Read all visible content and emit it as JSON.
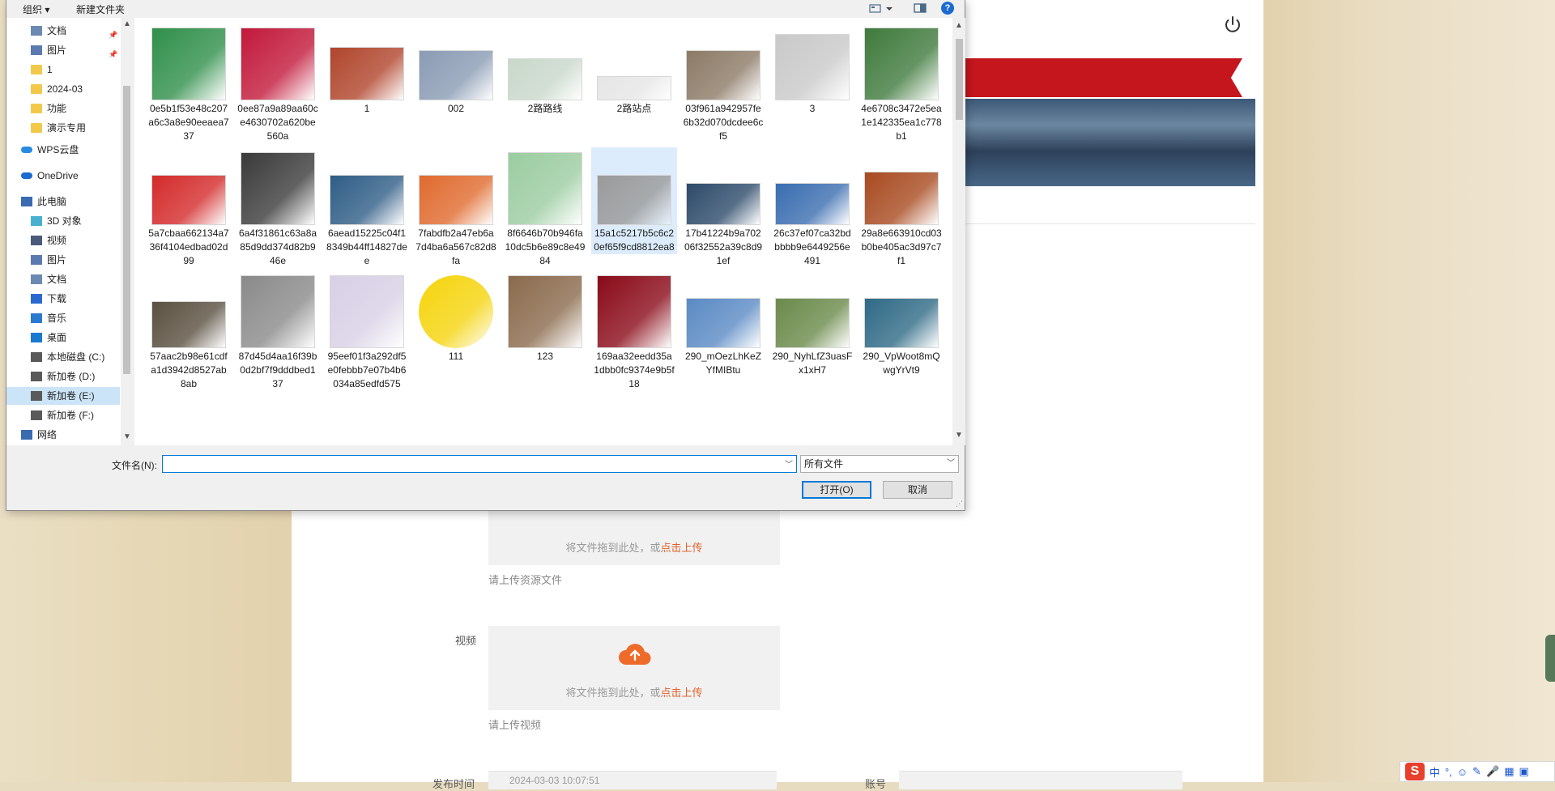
{
  "background": {
    "upload_resource": {
      "hint": "将文件拖到此处，或",
      "link": "点击上传",
      "sub": "请上传资源文件"
    },
    "video": {
      "label": "视频",
      "hint": "将文件拖到此处，或",
      "link": "点击上传",
      "sub": "请上传视频"
    },
    "publish_time": {
      "label": "发布时间",
      "value": "2024-03-03 10:07:51"
    },
    "account": {
      "label": "账号"
    }
  },
  "dialog": {
    "toolbar": {
      "organize": "组织 ▾",
      "new_folder": "新建文件夹",
      "help": "?"
    },
    "nav": [
      {
        "label": "文档",
        "icon": "document-icon",
        "pinned": true
      },
      {
        "label": "图片",
        "icon": "pictures-icon",
        "pinned": true
      },
      {
        "label": "1",
        "icon": "folder-icon"
      },
      {
        "label": "2024-03",
        "icon": "folder-icon"
      },
      {
        "label": "功能",
        "icon": "folder-icon"
      },
      {
        "label": "演示专用",
        "icon": "folder-icon"
      },
      {
        "label": "WPS云盘",
        "icon": "cloud-icon"
      },
      {
        "label": "OneDrive",
        "icon": "onedrive-icon"
      },
      {
        "label": "此电脑",
        "icon": "computer-icon"
      },
      {
        "label": "3D 对象",
        "icon": "3d-objects-icon"
      },
      {
        "label": "视频",
        "icon": "video-icon"
      },
      {
        "label": "图片",
        "icon": "pictures-icon"
      },
      {
        "label": "文档",
        "icon": "document-icon"
      },
      {
        "label": "下载",
        "icon": "download-icon"
      },
      {
        "label": "音乐",
        "icon": "music-icon"
      },
      {
        "label": "桌面",
        "icon": "desktop-icon"
      },
      {
        "label": "本地磁盘 (C:)",
        "icon": "drive-icon"
      },
      {
        "label": "新加卷 (D:)",
        "icon": "drive-icon"
      },
      {
        "label": "新加卷 (E:)",
        "icon": "drive-icon",
        "selected": true
      },
      {
        "label": "新加卷 (F:)",
        "icon": "drive-icon"
      },
      {
        "label": "网络",
        "icon": "network-icon"
      }
    ],
    "files": [
      {
        "name": "0e5b1f53e48c207a6c3a8e90eeaea737",
        "color": "#2f8f4a"
      },
      {
        "name": "0ee87a9a89aa60ce4630702a620be560a",
        "color": "#c2183a"
      },
      {
        "name": "1",
        "color": "#b0452c"
      },
      {
        "name": "002",
        "color": "#8a9bb4"
      },
      {
        "name": "2路路线",
        "color": "#c9d8cb"
      },
      {
        "name": "2路站点",
        "color": "#e6e6e6"
      },
      {
        "name": "03f961a942957fe6b32d070dcdee6cf5",
        "color": "#8c7a66"
      },
      {
        "name": "3",
        "color": "#c9c9c9"
      },
      {
        "name": "4e6708c3472e5ea1e142335ea1c778b1",
        "color": "#3f7a3c"
      },
      {
        "name": "5a7cbaa662134a736f4104edbad02d99",
        "color": "#d42a2a"
      },
      {
        "name": "6a4f31861c63a8a85d9dd374d82b946e",
        "color": "#3a3a3a"
      },
      {
        "name": "6aead15225c04f18349b44ff14827dee",
        "color": "#2f5d86"
      },
      {
        "name": "7fabdfb2a47eb6a7d4ba6a567c82d8fa",
        "color": "#e06a2e"
      },
      {
        "name": "8f6646b70b946fa10dc5b6e89c8e4984",
        "color": "#9bcca0"
      },
      {
        "name": "15a1c5217b5c6c20ef65f9cd8812ea8",
        "color": "#9a9a9a",
        "selected": true
      },
      {
        "name": "17b41224b9a70206f32552a39c8d91ef",
        "color": "#2d4a6a"
      },
      {
        "name": "26c37ef07ca32bdbbbb9e6449256e491",
        "color": "#3a6db0"
      },
      {
        "name": "29a8e663910cd03b0be405ac3d97c7f1",
        "color": "#a84a20"
      },
      {
        "name": "57aac2b98e61cdfa1d3942d8527ab8ab",
        "color": "#5a5040"
      },
      {
        "name": "87d45d4aa16f39b0d2bf7f9dddbed137",
        "color": "#8a8a8a"
      },
      {
        "name": "95eef01f3a292df5e0febbb7e07b4b6034a85edfd575",
        "color": "#d8d0e6"
      },
      {
        "name": "111",
        "color": "#f5d40c"
      },
      {
        "name": "123",
        "color": "#8a6a4c"
      },
      {
        "name": "169aa32eedd35a1dbb0fc9374e9b5f18",
        "color": "#8a0a18"
      },
      {
        "name": "290_mOezLhKeZYfMIBtu",
        "color": "#5a8ac4"
      },
      {
        "name": "290_NyhLfZ3uasFx1xH7",
        "color": "#6a8a4a"
      },
      {
        "name": "290_VpWoot8mQwgYrVt9",
        "color": "#2f6a86"
      },
      {
        "name": "",
        "color": "#6a6a8a"
      },
      {
        "name": "",
        "color": "#7a5030"
      },
      {
        "name": "",
        "color": "#d0408a"
      },
      {
        "name": "",
        "color": "#ffffff"
      },
      {
        "name": "",
        "color": "#e6e6e6"
      },
      {
        "name": "",
        "color": "#a03030"
      },
      {
        "name": "",
        "color": "#9a9a9a"
      },
      {
        "name": "",
        "color": "#88b8a8"
      },
      {
        "name": "",
        "color": "#ffffff"
      }
    ],
    "filename_label": "文件名(N):",
    "filename_value": "",
    "filter_value": "所有文件",
    "open_button": "打开(O)",
    "cancel_button": "取消"
  },
  "ime": {
    "lang": "中",
    "punct": "°,"
  }
}
